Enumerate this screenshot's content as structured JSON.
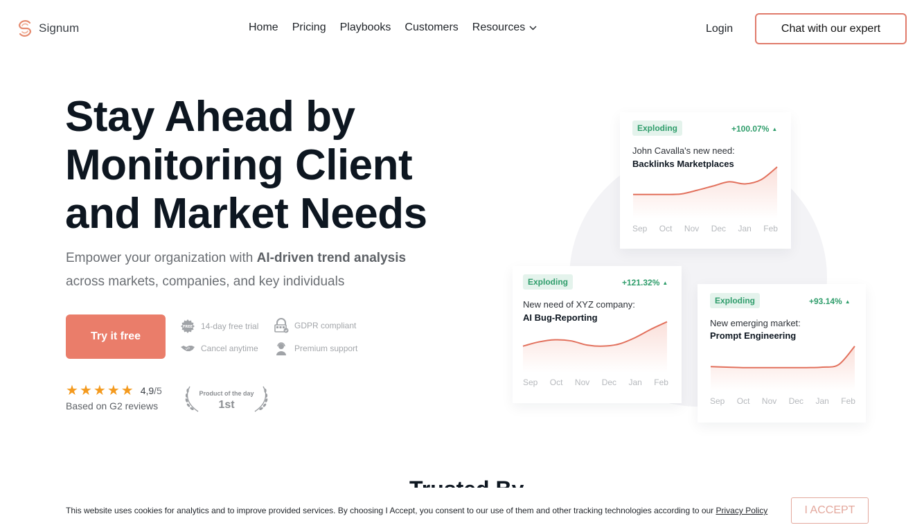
{
  "nav": {
    "brand": "Signum",
    "links": [
      "Home",
      "Pricing",
      "Playbooks",
      "Customers",
      "Resources"
    ],
    "login": "Login",
    "cta": "Chat with our expert"
  },
  "hero": {
    "headline": "Stay Ahead by Monitoring Client and Market Needs",
    "sub_plain": "Empower your organization with ",
    "sub_bold": "AI-driven trend analysis",
    "sub_rest": "across markets, companies, and key individuals",
    "try_button": "Try it free",
    "features": [
      {
        "icon": "free-badge-icon",
        "label": "14-day free trial"
      },
      {
        "icon": "gdpr-lock-icon",
        "label": "GDPR compliant"
      },
      {
        "icon": "handshake-icon",
        "label": "Cancel anytime"
      },
      {
        "icon": "support-agent-icon",
        "label": "Premium support"
      }
    ],
    "rating": {
      "stars": 5,
      "score": "4,9",
      "max": "/5",
      "source": "Based on G2 reviews"
    },
    "award": {
      "line1": "Product of the day",
      "line2": "1st"
    }
  },
  "cards": [
    {
      "badge": "Exploding",
      "change": "+100.07%",
      "lead": "John Cavalla's new need:",
      "title": "Backlinks Marketplaces",
      "months": [
        "Sep",
        "Oct",
        "Nov",
        "Dec",
        "Jan",
        "Feb"
      ],
      "values": [
        20,
        20,
        20,
        20.5,
        24,
        28,
        32,
        30,
        34,
        46
      ]
    },
    {
      "badge": "Exploding",
      "change": "+121.32%",
      "lead": "New need of XYZ company:",
      "title": "AI Bug-Reporting",
      "months": [
        "Sep",
        "Oct",
        "Nov",
        "Dec",
        "Jan",
        "Feb"
      ],
      "values": [
        22,
        26,
        28,
        27,
        23,
        22,
        24,
        30,
        38,
        45
      ]
    },
    {
      "badge": "Exploding",
      "change": "+93.14%",
      "lead": "New emerging market:",
      "title": "Prompt Engineering",
      "months": [
        "Sep",
        "Oct",
        "Nov",
        "Dec",
        "Jan",
        "Feb"
      ],
      "values": [
        20,
        19.5,
        19,
        19,
        19,
        19,
        19,
        19.5,
        22,
        40
      ]
    }
  ],
  "trusted": "Trusted By",
  "cookie": {
    "text": "This website uses cookies for analytics and to improve provided services. By choosing I Accept, you consent to our use of them and other tracking technologies according to our ",
    "link": "Privacy Policy",
    "accept": "I ACCEPT"
  }
}
